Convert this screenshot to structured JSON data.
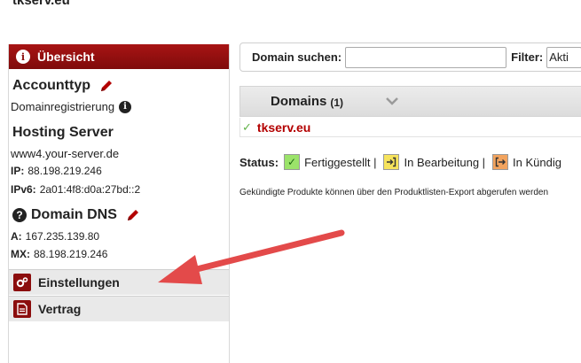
{
  "site": {
    "title": "tkserv.eu"
  },
  "sidebar": {
    "header": "Übersicht",
    "account_title": "Accounttyp",
    "account_type": "Domainregistrierung",
    "hosting_title": "Hosting Server",
    "hosting_host": "www4.your-server.de",
    "ip_label": "IP:",
    "ip_value": "88.198.219.246",
    "ipv6_label": "IPv6:",
    "ipv6_value": "2a01:4f8:d0a:27bd::2",
    "dns_title": "Domain DNS",
    "dns_a_label": "A:",
    "dns_a_value": "167.235.139.80",
    "dns_mx_label": "MX:",
    "dns_mx_value": "88.198.219.246",
    "menu": [
      {
        "label": "Einstellungen",
        "icon": "gears-icon"
      },
      {
        "label": "Vertrag",
        "icon": "document-icon"
      }
    ],
    "accent": "#8b0d0d"
  },
  "search": {
    "label": "Domain suchen:",
    "value": "",
    "filter_label": "Filter:",
    "filter_value": "Akti"
  },
  "domains": {
    "tab_label": "Domains",
    "count": "(1)",
    "rows": [
      {
        "name": "tkserv.eu",
        "status": "check-icon"
      }
    ]
  },
  "status": {
    "label": "Status:",
    "items": [
      {
        "label": "Fertiggestellt |",
        "icon": "check-icon"
      },
      {
        "label": "In Bearbeitung |",
        "icon": "sign-in-icon"
      },
      {
        "label": "In Kündig",
        "icon": "sign-out-icon"
      }
    ]
  },
  "note": "Gekündigte Produkte können über den Produktlisten-Export abgerufen werden"
}
